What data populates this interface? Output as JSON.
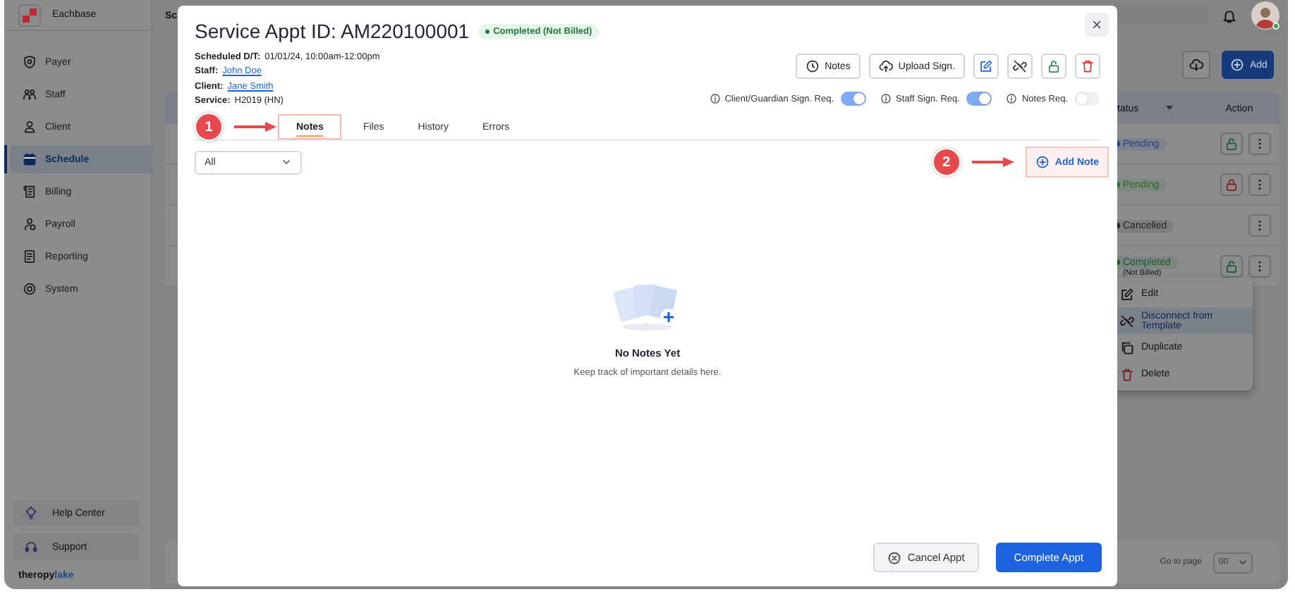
{
  "sidebar": {
    "brand": "Eachbase",
    "items": [
      {
        "label": "Payer",
        "selected": false
      },
      {
        "label": "Staff",
        "selected": false
      },
      {
        "label": "Client",
        "selected": false
      },
      {
        "label": "Schedule",
        "selected": true
      },
      {
        "label": "Billing",
        "selected": false
      },
      {
        "label": "Payroll",
        "selected": false
      },
      {
        "label": "Reporting",
        "selected": false
      },
      {
        "label": "System",
        "selected": false
      }
    ],
    "help_items": [
      {
        "label": "Help Center"
      },
      {
        "label": "Support"
      }
    ],
    "logo": {
      "text": "theropy",
      "accent": "lake"
    }
  },
  "page": {
    "title": "Sc",
    "add_button": "Add",
    "table": {
      "columns": [
        "tatus",
        "Action"
      ],
      "rows": [
        {
          "status": "Pending",
          "color": "#23418a",
          "locked": false
        },
        {
          "status": "Pending",
          "color": "#2a6a2a",
          "locked": true
        },
        {
          "status": "Cancelled",
          "color": "#222222"
        },
        {
          "status": "Completed",
          "color": "#1d5a30",
          "note": "(Not Billed)",
          "locked": false
        }
      ]
    },
    "menu": [
      {
        "label": "Edit",
        "selected": false
      },
      {
        "label": "Disconnect from Template",
        "selected": true
      },
      {
        "label": "Duplicate",
        "selected": false
      },
      {
        "label": "Delete",
        "selected": false
      }
    ],
    "pagination": {
      "label": "Go to page",
      "page": "00"
    }
  },
  "modal": {
    "title": "Service Appt ID: AM220100001",
    "status_badge": "Completed (Not Billed)",
    "details": [
      {
        "label": "Scheduled D/T:",
        "value": "01/01/24, 10:00am-12:00pm",
        "kind": "text"
      },
      {
        "label": "Staff:",
        "value": "John Doe",
        "kind": "link"
      },
      {
        "label": "Client:",
        "value": "Jane Smith",
        "kind": "link"
      },
      {
        "label": "Service:",
        "value": "H2019 (HN)",
        "kind": "text"
      }
    ],
    "actions": [
      {
        "kind": "text",
        "label": "Notes"
      },
      {
        "kind": "text",
        "label": "Upload Sign."
      },
      {
        "kind": "icon"
      },
      {
        "kind": "icon"
      },
      {
        "kind": "icon"
      },
      {
        "kind": "icon"
      }
    ],
    "toggles": [
      {
        "label": "Client/Guardian Sign. Req.",
        "on": true
      },
      {
        "label": "Staff Sign. Req.",
        "on": true
      },
      {
        "label": "Notes Req.",
        "on": false
      }
    ],
    "annotations": [
      {
        "label": "1"
      },
      {
        "label": "2"
      }
    ],
    "tabs": [
      {
        "label": "Notes",
        "selected": true,
        "highlighted": true
      },
      {
        "label": "Files",
        "selected": false,
        "highlighted": false
      },
      {
        "label": "History",
        "selected": false,
        "highlighted": false
      },
      {
        "label": "Errors",
        "selected": false,
        "highlighted": false
      }
    ],
    "filter": {
      "value": "All"
    },
    "add_note": {
      "label": "Add Note",
      "highlighted": true
    },
    "empty": {
      "title": "No Notes Yet",
      "message": "Keep track of important details here."
    },
    "footer_buttons": [
      {
        "label": "Cancel Appt",
        "kind": "secondary"
      },
      {
        "label": "Complete Appt",
        "kind": "primary"
      }
    ]
  }
}
